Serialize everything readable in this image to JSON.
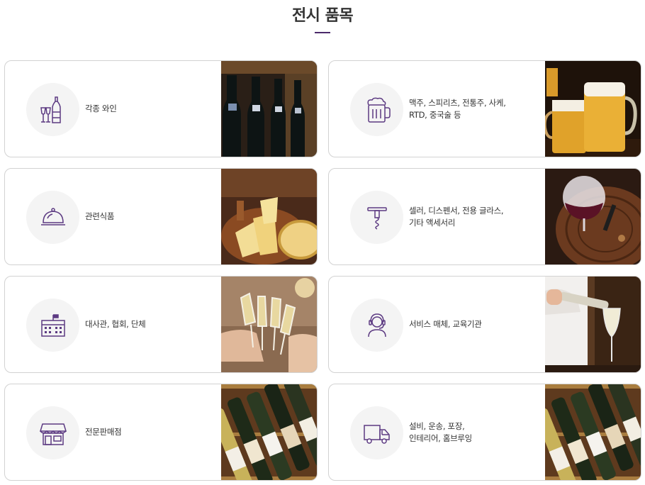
{
  "section": {
    "title": "전시 품목"
  },
  "items": [
    {
      "label": "각종 와인",
      "icon": "wine-bottle-glasses-icon",
      "photo": "wine-bottles-photo"
    },
    {
      "label": "맥주, 스피리츠, 전통주, 사케,\nRTD, 중국술 등",
      "icon": "beer-mug-icon",
      "photo": "beer-mugs-photo"
    },
    {
      "label": "관련식품",
      "icon": "food-cloche-icon",
      "photo": "cheese-board-photo"
    },
    {
      "label": "셀러, 디스펜서, 전용 글라스,\n기타 액세서리",
      "icon": "corkscrew-icon",
      "photo": "wine-glass-barrel-photo"
    },
    {
      "label": "대사관, 협회, 단체",
      "icon": "embassy-building-icon",
      "photo": "champagne-toast-photo"
    },
    {
      "label": "서비스 매체, 교육기관",
      "icon": "headset-person-icon",
      "photo": "wine-pouring-photo"
    },
    {
      "label": "전문판매점",
      "icon": "store-front-icon",
      "photo": "wine-crate-photo"
    },
    {
      "label": "설비, 운송, 포장,\n인테리어, 홈브루잉",
      "icon": "delivery-truck-icon",
      "photo": "wine-crate-photo"
    }
  ],
  "colors": {
    "accent": "#5c3a82",
    "border": "#d2d2d2",
    "icon_bg": "#f4f4f4"
  }
}
